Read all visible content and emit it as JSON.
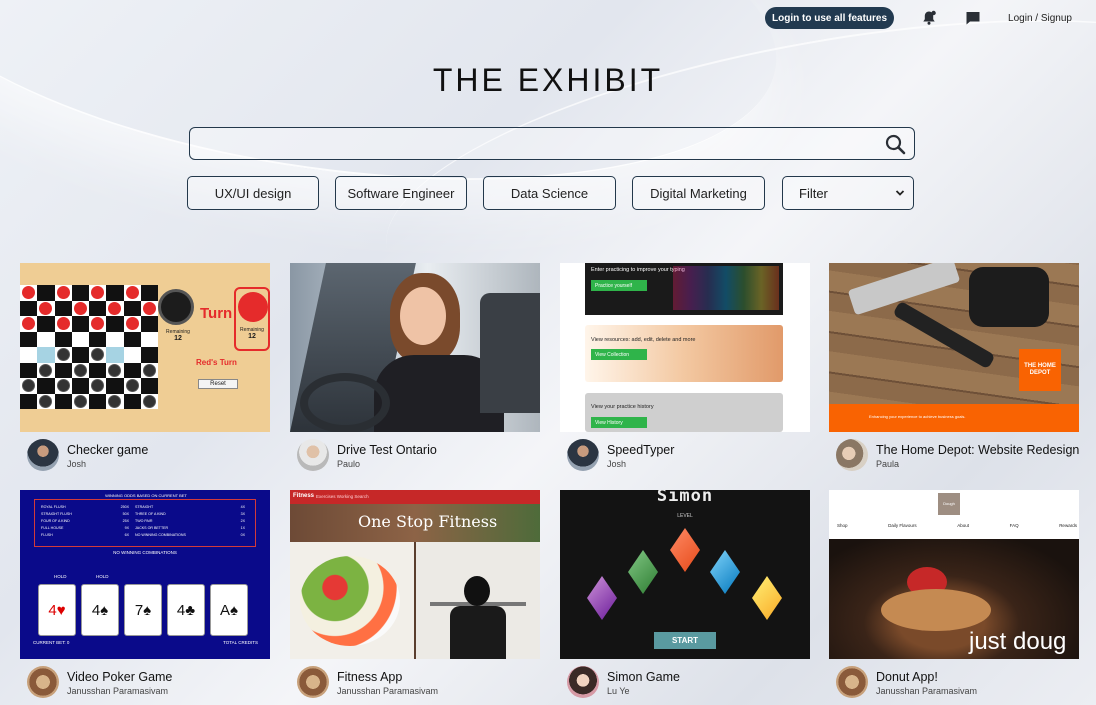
{
  "nav": {
    "login_pill": "Login to use all features",
    "login_signup": "Login / Signup",
    "icons": [
      "bell-icon",
      "chat-icon"
    ]
  },
  "title": "THE EXHIBIT",
  "search": {
    "placeholder": "",
    "icon": "search-icon"
  },
  "categories": [
    "UX/UI design",
    "Software Engineer",
    "Data Science",
    "Digital Marketing"
  ],
  "filter": {
    "selected": "Filter"
  },
  "projects": [
    {
      "title": "Checker game",
      "author": "Josh"
    },
    {
      "title": "Drive Test Ontario",
      "author": "Paulo"
    },
    {
      "title": "SpeedTyper",
      "author": "Josh"
    },
    {
      "title": "The Home Depot: Website Redesign",
      "author": "Paula"
    },
    {
      "title": "Video Poker Game",
      "author": "Janusshan Paramasivam"
    },
    {
      "title": "Fitness App",
      "author": "Janusshan Paramasivam"
    },
    {
      "title": "Simon Game",
      "author": "Lu Ye"
    },
    {
      "title": "Donut App!",
      "author": "Janusshan Paramasivam"
    }
  ],
  "thumbs": {
    "checker": {
      "turn": "Turn",
      "status": "Red's Turn",
      "reset": "Reset",
      "remaining_label": "Remaining",
      "remaining_black": "12",
      "remaining_red": "12"
    },
    "speedtyper": {
      "panel1": "Enter practicing to improve your typing",
      "btn1": "Practice yourself",
      "panel2": "View resources: add, edit, delete and more",
      "btn2": "View Collection",
      "panel3": "View your practice history",
      "btn3": "View History"
    },
    "homedepot": {
      "logo": "THE HOME DEPOT",
      "footer": "Enhancing your experience to achieve business goals."
    },
    "poker": {
      "header": "WINNING ODDS BASED ON CURRENT BET",
      "rows": [
        [
          "ROYAL FLUSH",
          "250X",
          "STRAIGHT",
          "4X"
        ],
        [
          "STRAIGHT FLUSH",
          "50X",
          "THREE OF A KIND",
          "3X"
        ],
        [
          "FOUR OF A KIND",
          "25X",
          "TWO PAIR",
          "2X"
        ],
        [
          "FULL HOUSE",
          "9X",
          "JACKS OR BETTER",
          "1X"
        ],
        [
          "FLUSH",
          "6X",
          "NO WINNING COMBINATIONS",
          "0X"
        ]
      ],
      "no_win": "NO WINNING COMBINATIONS",
      "hold": "HOLD",
      "cards": [
        "4♥",
        "4♠",
        "7♠",
        "4♣",
        "A♠"
      ],
      "current_bet": "CURRENT BET: 0",
      "total_credits": "TOTAL CREDITS"
    },
    "fitness": {
      "brand": "Fitness",
      "nav": "Exercises  Working Search",
      "headline": "One Stop Fitness"
    },
    "simon": {
      "title": "Simon",
      "level": "LEVEL",
      "start": "START"
    },
    "donut": {
      "menu": [
        "Shop",
        "Daily Flavours",
        "About",
        "FAQ",
        "Rewards"
      ],
      "brand": "Dough",
      "slogan": "just doug"
    }
  },
  "colors": {
    "accent": "#223a50",
    "border": "#23384b",
    "homedepot_orange": "#f96302",
    "speedtyper_green": "#2fb44a"
  }
}
